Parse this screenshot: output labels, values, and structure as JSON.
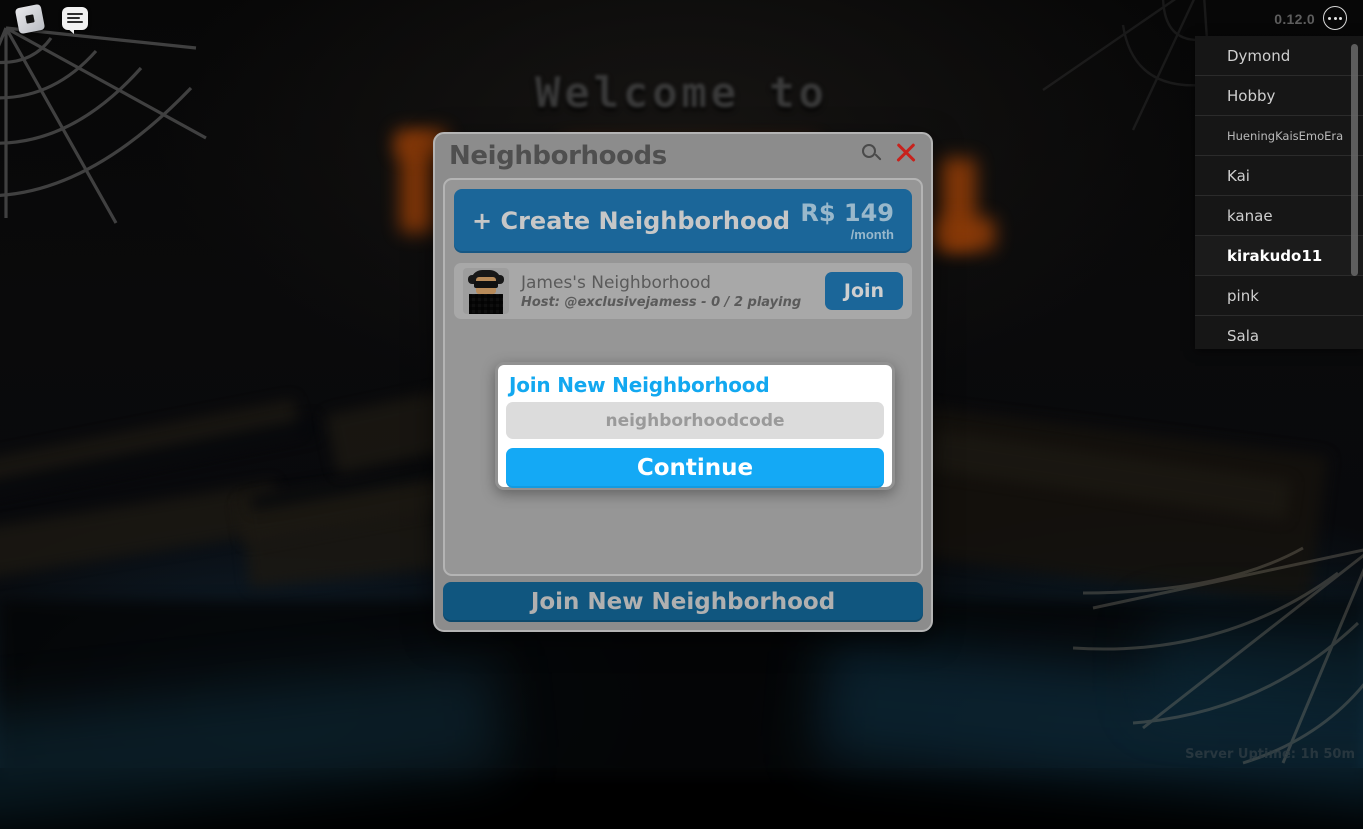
{
  "topbar": {
    "roblox_logo_icon": "roblox-logo-icon",
    "chat_icon": "chat-icon",
    "version": "0.12.0",
    "more_icon": "more-options-icon"
  },
  "background": {
    "welcome_text": "Welcome  to"
  },
  "player_list": {
    "players": [
      {
        "name": "Dymond",
        "style": "normal"
      },
      {
        "name": "Hobby",
        "style": "normal"
      },
      {
        "name": "HueningKaisEmoEra",
        "style": "small"
      },
      {
        "name": "Kai",
        "style": "normal"
      },
      {
        "name": "kanae",
        "style": "normal"
      },
      {
        "name": "kirakudo11",
        "style": "self"
      },
      {
        "name": "pink",
        "style": "normal"
      },
      {
        "name": "Sala",
        "style": "normal"
      }
    ]
  },
  "panel": {
    "title": "Neighborhoods",
    "search_icon": "search-icon",
    "close_icon": "close-icon",
    "create": {
      "label": "+ Create Neighborhood",
      "price": "R$ 149",
      "price_period": "/month"
    },
    "neighborhood": {
      "name": "James's Neighborhood",
      "host": "Host: @exclusivejamess - 0 / 2 playing",
      "join_label": "Join"
    },
    "footer_button": "Join New Neighborhood"
  },
  "join_modal": {
    "title": "Join New Neighborhood",
    "code_placeholder": "neighborhoodcode",
    "continue_label": "Continue"
  },
  "status": {
    "uptime": "Server Uptime: 1h 50m"
  },
  "colors": {
    "accent_blue": "#1b6699",
    "bright_blue": "#14a9f5",
    "panel_gray": "#8c8c8c",
    "close_red": "#c8221c",
    "footer_blue": "#10567f"
  }
}
